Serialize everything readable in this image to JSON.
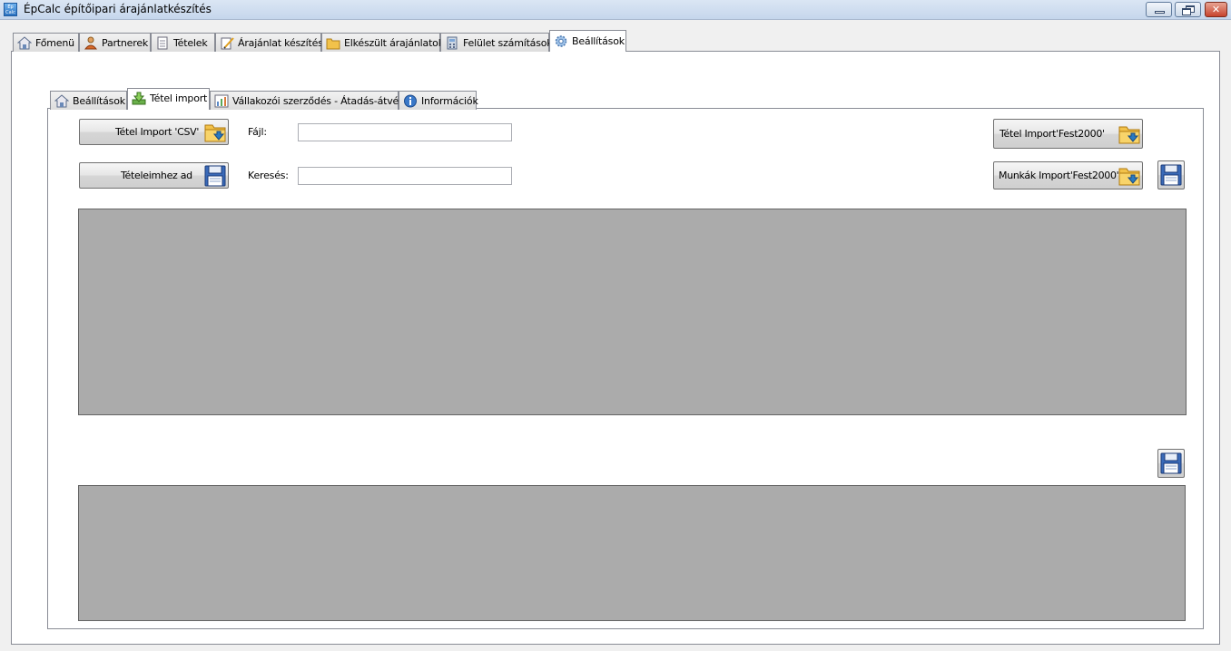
{
  "window": {
    "title": "ÉpCalc építőipari árajánlatkészítés",
    "app_icon_text": "Ép\nCalc"
  },
  "main_tabs": [
    {
      "label": "Főmenü",
      "icon": "home-icon"
    },
    {
      "label": "Partnerek",
      "icon": "partners-icon"
    },
    {
      "label": "Tételek",
      "icon": "document-icon"
    },
    {
      "label": "Árajánlat készítés",
      "icon": "edit-icon"
    },
    {
      "label": "Elkészült árajánlatok",
      "icon": "folder-icon"
    },
    {
      "label": "Felület számítások",
      "icon": "calculator-icon"
    },
    {
      "label": "Beállítások",
      "icon": "gear-icon",
      "active": true
    }
  ],
  "inner_tabs": [
    {
      "label": "Beállítások",
      "icon": "home-icon"
    },
    {
      "label": "Tétel import",
      "icon": "import-icon",
      "active": true
    },
    {
      "label": "Vállakozói szerződés - Átadás-átvétel",
      "icon": "chart-icon"
    },
    {
      "label": "Információk",
      "icon": "info-icon"
    }
  ],
  "import": {
    "csv_button": "Tétel Import 'CSV'",
    "add_button": "Tételeimhez ad",
    "file_label": "Fájl:",
    "file_value": "",
    "search_label": "Keresés:",
    "search_value": "",
    "fest_button": "Tétel Import'Fest2000'",
    "munkak_button": "Munkák Import'Fest2000'"
  },
  "colors": {
    "grid_background": "#ababab",
    "panel_background": "#ffffff",
    "window_background": "#f0f0f0"
  }
}
